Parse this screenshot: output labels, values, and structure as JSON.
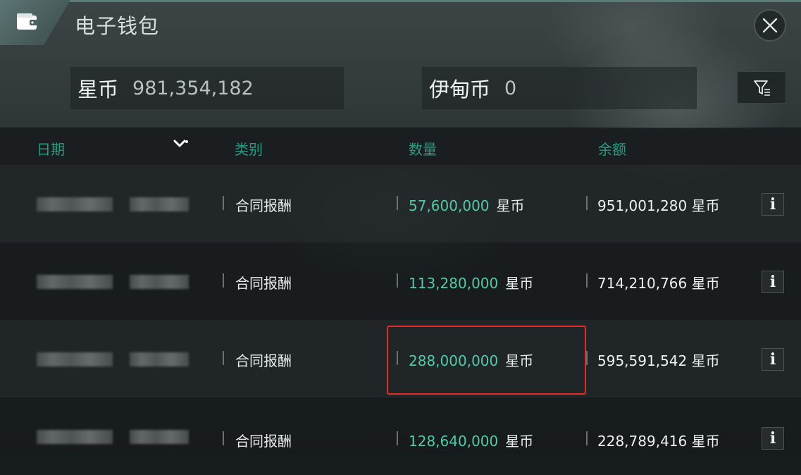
{
  "window": {
    "title": "电子钱包",
    "icons": {
      "wallet": "wallet-icon",
      "close": "close-icon",
      "filter": "filter-icon",
      "sort": "chevron-down-icon",
      "info": "info-icon"
    }
  },
  "balances": [
    {
      "name": "星币",
      "value": "981,354,182"
    },
    {
      "name": "伊甸币",
      "value": "0"
    }
  ],
  "table": {
    "headers": {
      "date": "日期",
      "category": "类别",
      "amount": "数量",
      "balance": "余额"
    },
    "rows": [
      {
        "category": "合同报酬",
        "amount": "57,600,000",
        "amount_unit": "星币",
        "balance": "951,001,280 星币",
        "info": "i"
      },
      {
        "category": "合同报酬",
        "amount": "113,280,000",
        "amount_unit": "星币",
        "balance": "714,210,766 星币",
        "info": "i"
      },
      {
        "category": "合同报酬",
        "amount": "288,000,000",
        "amount_unit": "星币",
        "balance": "595,591,542 星币",
        "info": "i"
      },
      {
        "category": "合同报酬",
        "amount": "128,640,000",
        "amount_unit": "星币",
        "balance": "228,789,416 星币",
        "info": "i"
      }
    ]
  },
  "colors": {
    "accent": "#2c9b84",
    "amount": "#55c9a2",
    "highlight": "#e52b25"
  }
}
